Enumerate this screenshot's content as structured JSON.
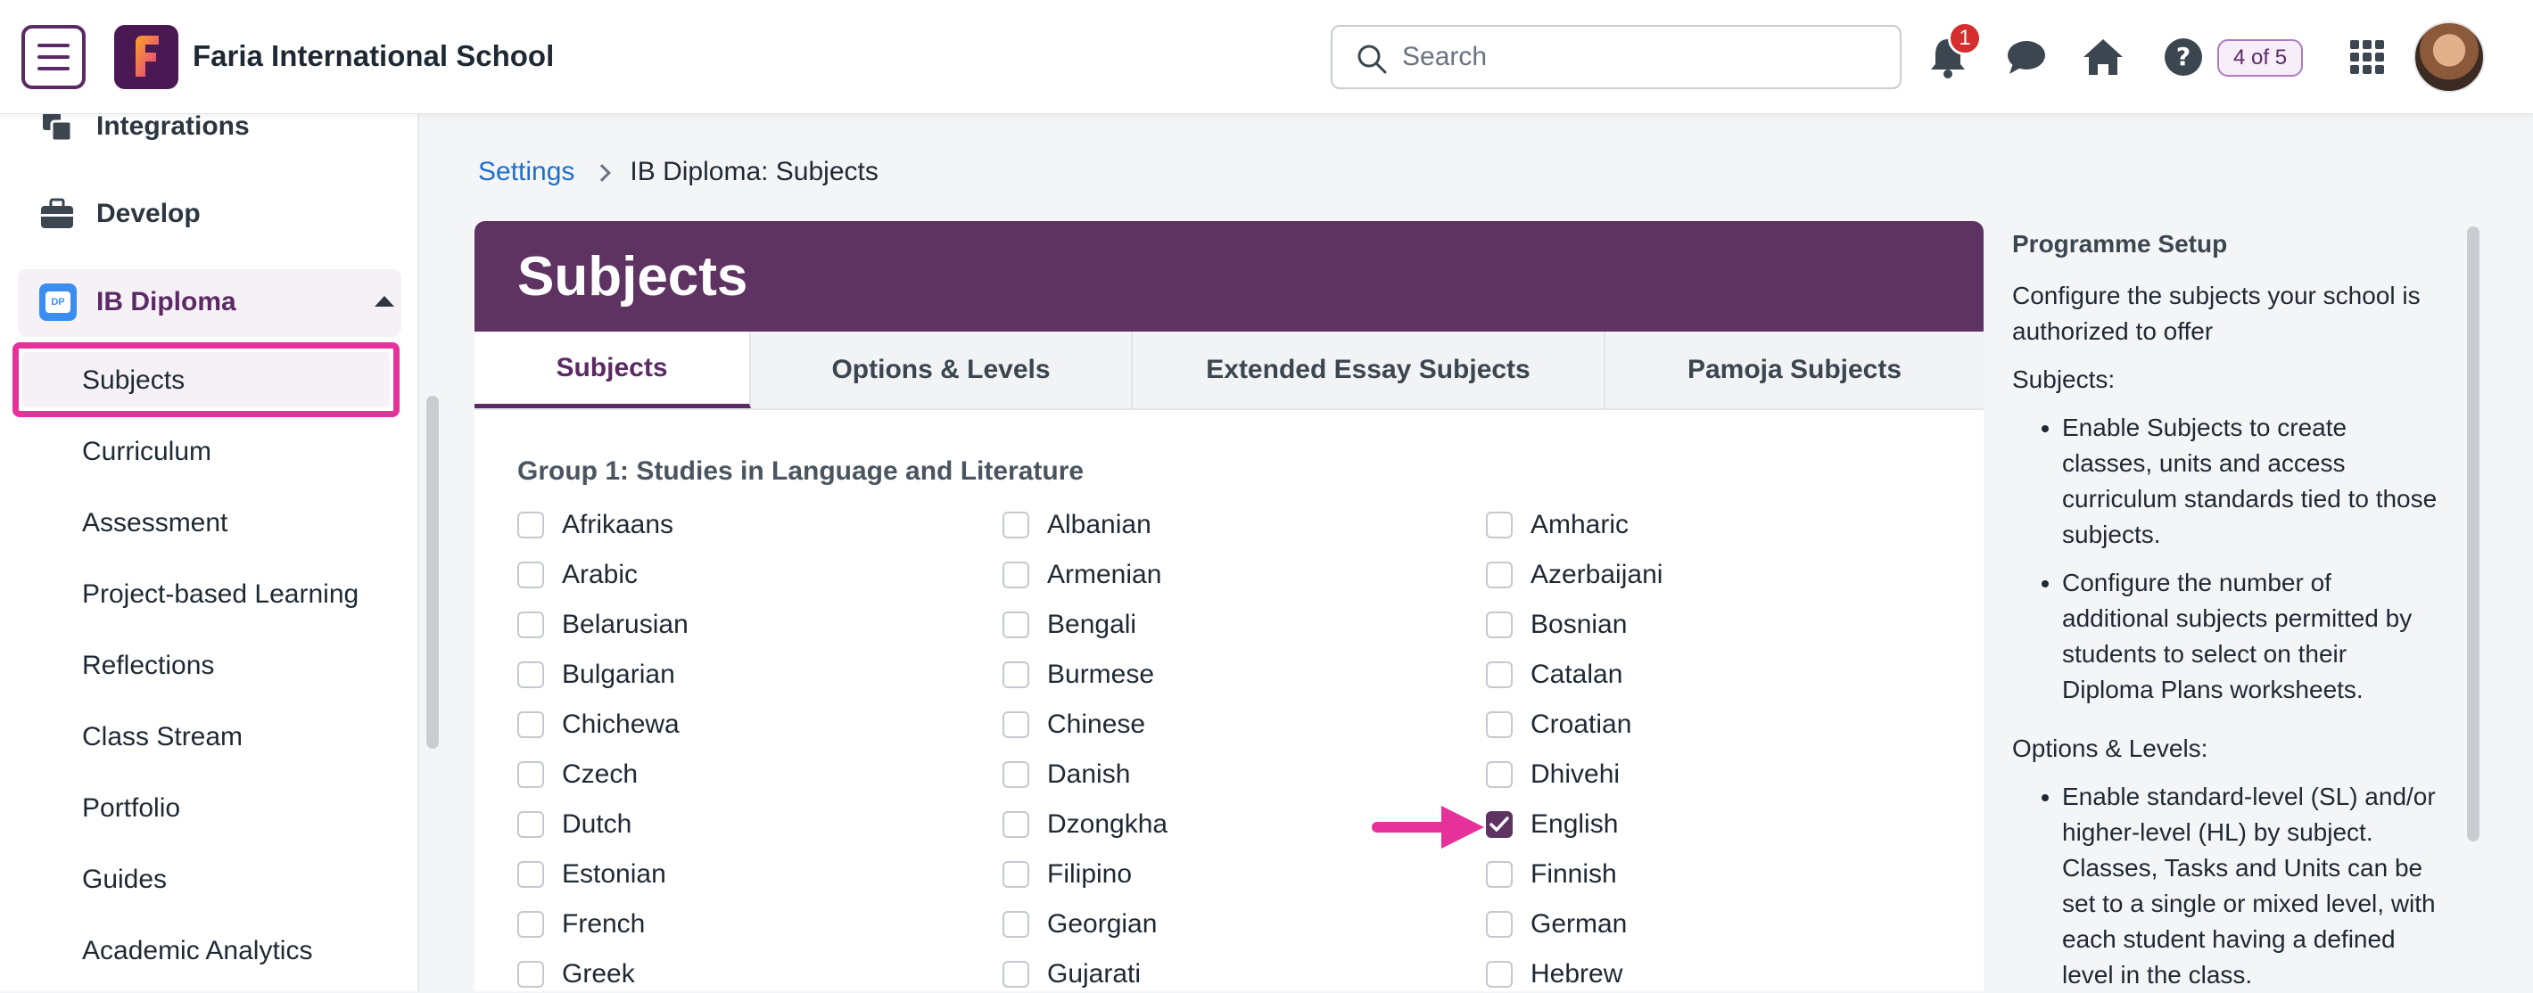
{
  "header": {
    "school_name": "Faria International School",
    "search_placeholder": "Search",
    "notification_count": "1",
    "pager": "4 of 5"
  },
  "sidebar": {
    "top_items": [
      {
        "label": "Integrations",
        "icon": "integrations-icon"
      },
      {
        "label": "Develop",
        "icon": "briefcase-icon"
      }
    ],
    "group": {
      "label": "IB Diploma",
      "icon": "ib-diploma-icon",
      "badge": "DP"
    },
    "sub_items": [
      "Subjects",
      "Curriculum",
      "Assessment",
      "Project-based Learning",
      "Reflections",
      "Class Stream",
      "Portfolio",
      "Guides",
      "Academic Analytics"
    ],
    "active": "Subjects"
  },
  "breadcrumb": {
    "root": "Settings",
    "current": "IB Diploma: Subjects"
  },
  "panel": {
    "title": "Subjects",
    "tabs": [
      "Subjects",
      "Options & Levels",
      "Extended Essay Subjects",
      "Pamoja Subjects"
    ],
    "active_tab": "Subjects",
    "group_title": "Group 1: Studies in Language and Literature",
    "subjects": [
      {
        "label": "Afrikaans",
        "checked": false
      },
      {
        "label": "Albanian",
        "checked": false
      },
      {
        "label": "Amharic",
        "checked": false
      },
      {
        "label": "Arabic",
        "checked": false
      },
      {
        "label": "Armenian",
        "checked": false
      },
      {
        "label": "Azerbaijani",
        "checked": false
      },
      {
        "label": "Belarusian",
        "checked": false
      },
      {
        "label": "Bengali",
        "checked": false
      },
      {
        "label": "Bosnian",
        "checked": false
      },
      {
        "label": "Bulgarian",
        "checked": false
      },
      {
        "label": "Burmese",
        "checked": false
      },
      {
        "label": "Catalan",
        "checked": false
      },
      {
        "label": "Chichewa",
        "checked": false
      },
      {
        "label": "Chinese",
        "checked": false
      },
      {
        "label": "Croatian",
        "checked": false
      },
      {
        "label": "Czech",
        "checked": false
      },
      {
        "label": "Danish",
        "checked": false
      },
      {
        "label": "Dhivehi",
        "checked": false
      },
      {
        "label": "Dutch",
        "checked": false
      },
      {
        "label": "Dzongkha",
        "checked": false
      },
      {
        "label": "English",
        "checked": true
      },
      {
        "label": "Estonian",
        "checked": false
      },
      {
        "label": "Filipino",
        "checked": false
      },
      {
        "label": "Finnish",
        "checked": false
      },
      {
        "label": "French",
        "checked": false
      },
      {
        "label": "Georgian",
        "checked": false
      },
      {
        "label": "German",
        "checked": false
      },
      {
        "label": "Greek",
        "checked": false
      },
      {
        "label": "Gujarati",
        "checked": false
      },
      {
        "label": "Hebrew",
        "checked": false
      }
    ]
  },
  "help": {
    "heading": "Programme Setup",
    "intro": "Configure the subjects your school is authorized to offer",
    "subjects_label": "Subjects:",
    "subjects_bullets": [
      "Enable Subjects to create classes, units and access curriculum standards tied to those subjects.",
      "Configure the number of additional subjects permitted by students to select on their Diploma Plans worksheets."
    ],
    "options_label": "Options & Levels:",
    "options_bullets": [
      "Enable standard-level (SL) and/or higher-level (HL) by subject. Classes, Tasks and Units can be set to a single or mixed level, with each student having a defined level in the class."
    ]
  },
  "colors": {
    "brand": "#5e3362",
    "highlight": "#e6309a",
    "link": "#1f6fc9",
    "badge": "#d62e2e"
  }
}
